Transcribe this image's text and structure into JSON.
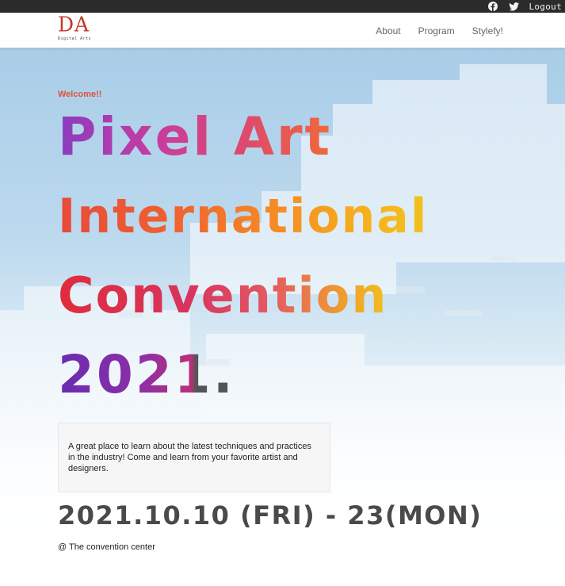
{
  "topbar": {
    "social_icons": [
      "facebook-icon",
      "twitter-icon"
    ],
    "logout_label": "Logout"
  },
  "navbar": {
    "logo_mark": "DA",
    "logo_tagline": "Digital Arts",
    "links": [
      "About",
      "Program",
      "Stylefy!"
    ]
  },
  "hero": {
    "welcome": "Welcome!!",
    "title_lines": [
      "Pixel Art",
      "International",
      "Convention",
      "2021."
    ],
    "description": "A great place to learn about the latest techniques and practices in the industry! Come and learn from your favorite artist and designers.",
    "dates": "2021.10.10 (FRI) - 23(MON)",
    "venue": "@ The convention center"
  },
  "colors": {
    "topbar_bg": "#2b2b2b",
    "logo_red": "#c23a2a",
    "welcome_orange": "#e0523a",
    "date_gray": "#4a4a4a",
    "sky_blue": "#a9cde8"
  }
}
